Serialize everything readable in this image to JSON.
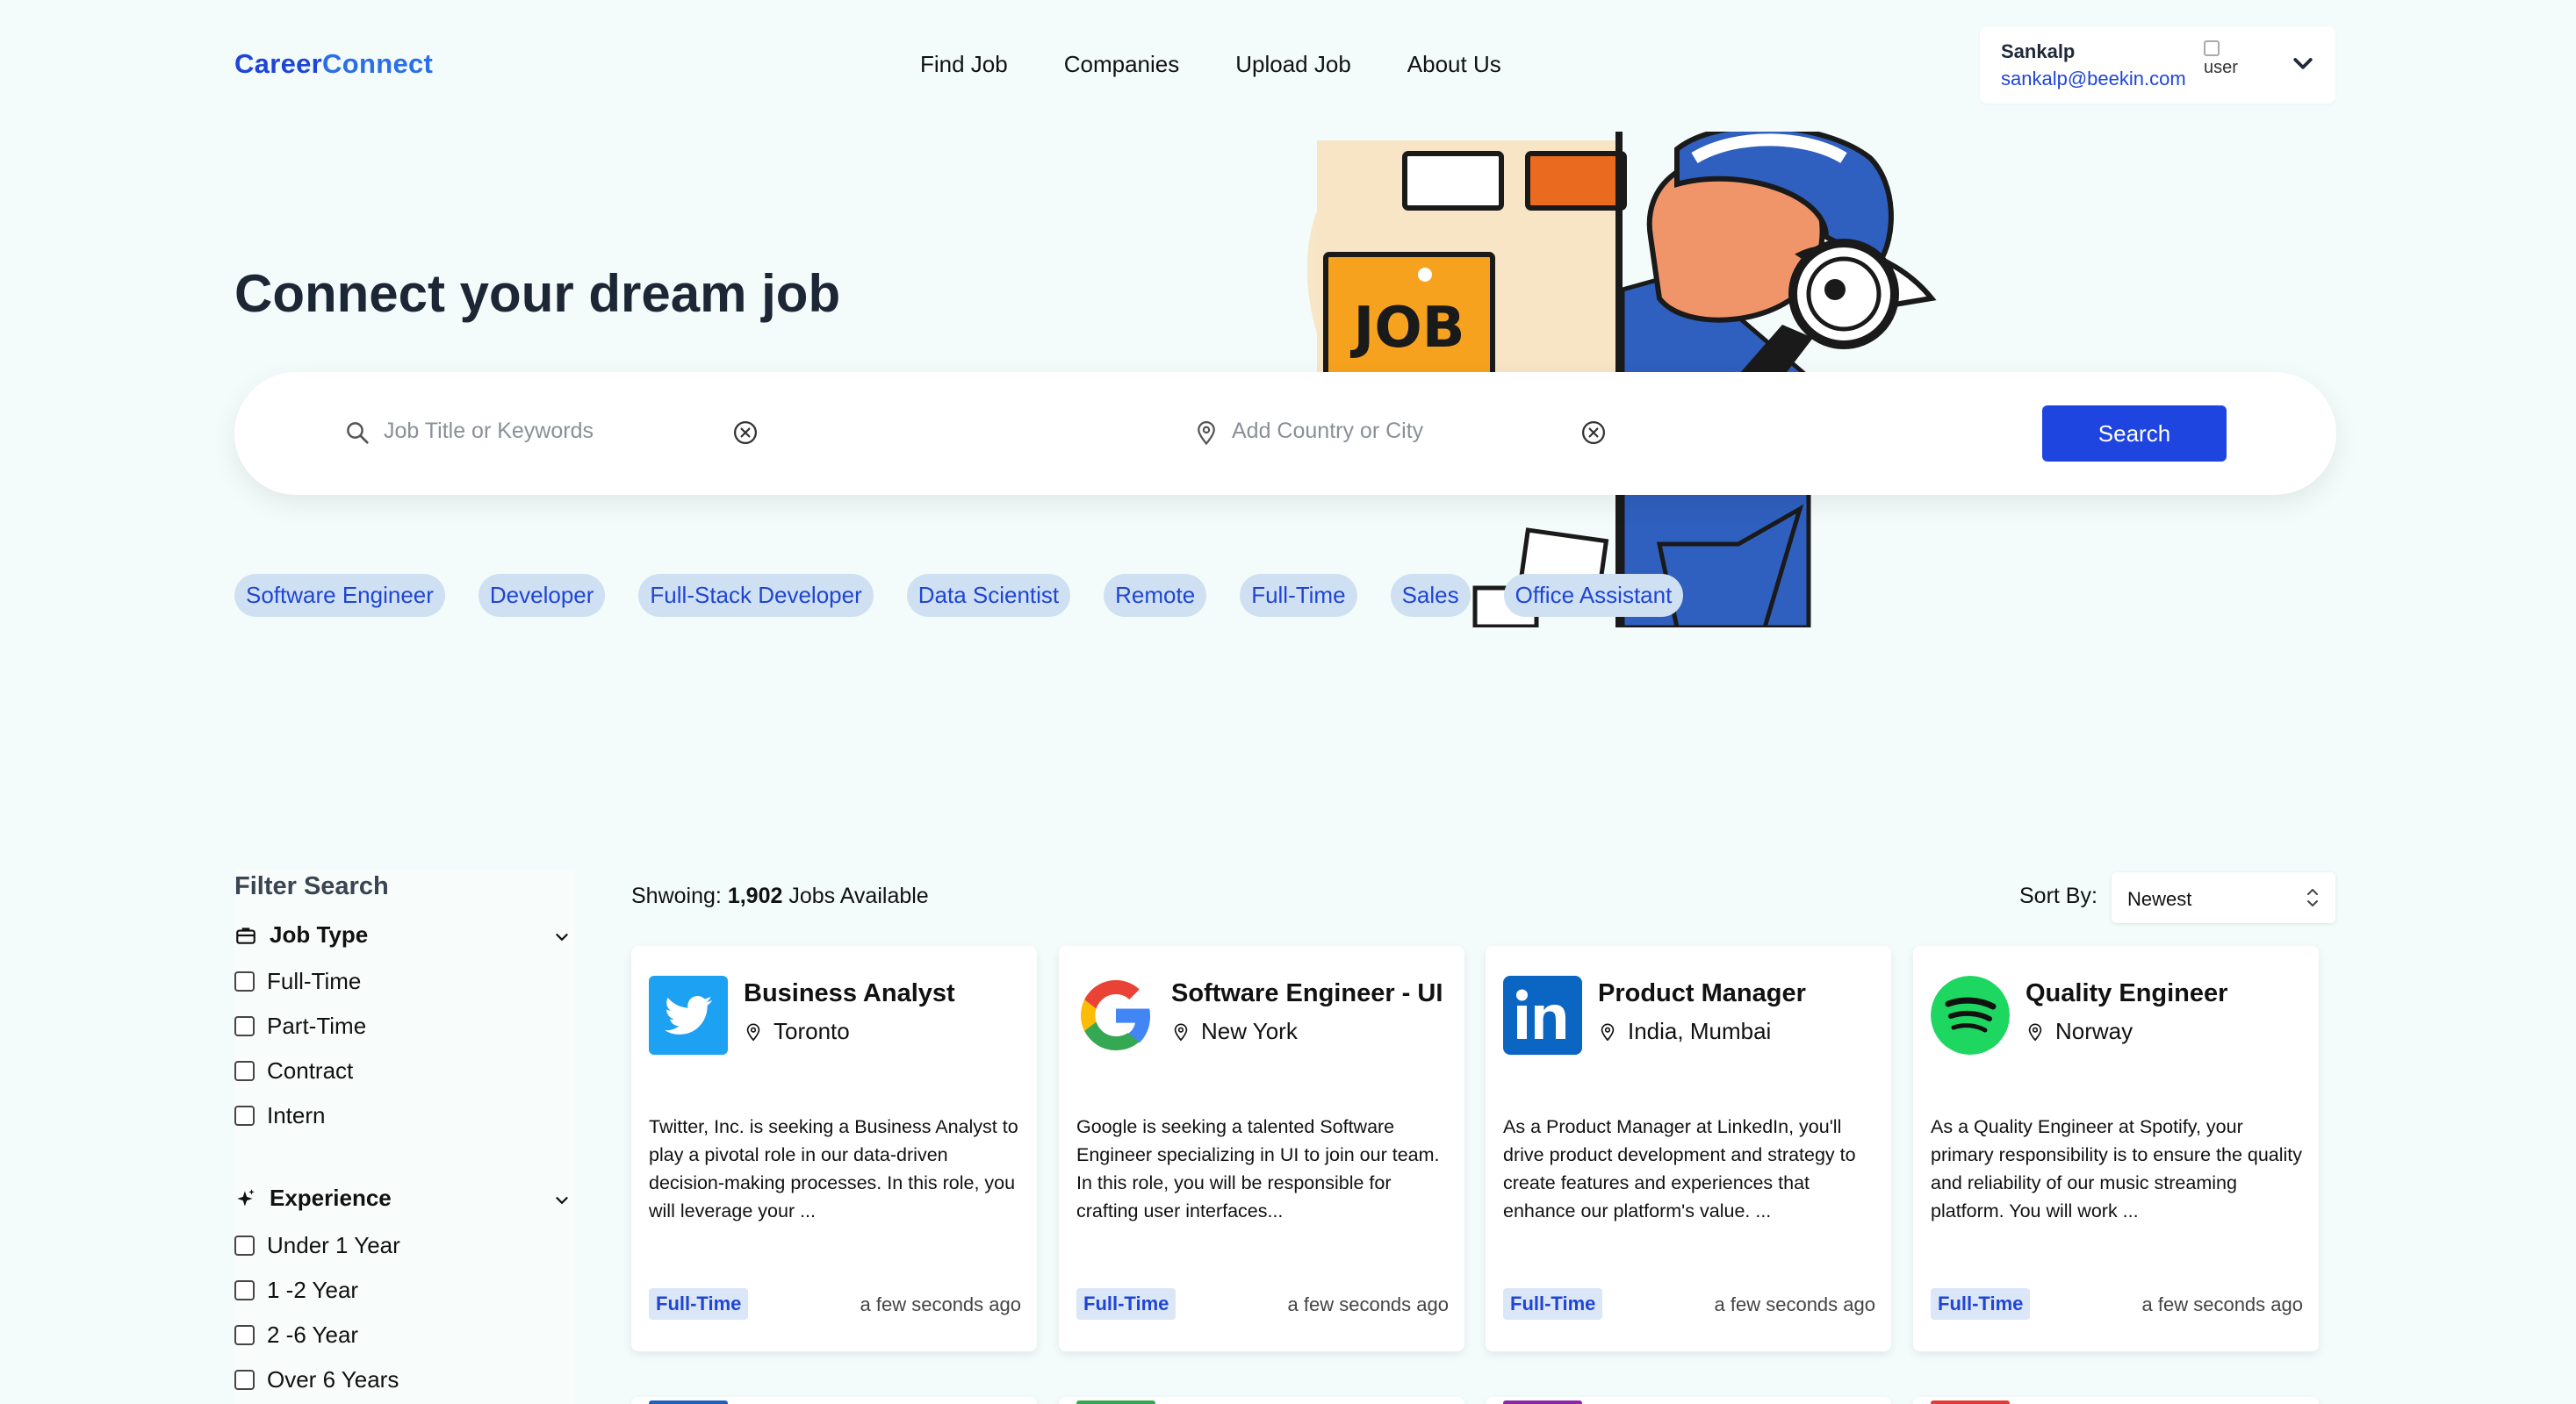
{
  "header": {
    "logo_part1": "Career",
    "logo_part2": "Connect",
    "nav": [
      "Find Job",
      "Companies",
      "Upload Job",
      "About Us"
    ],
    "user": {
      "name": "Sankalp",
      "email": "sankalp@beekin.com",
      "avatar_alt": "user"
    }
  },
  "hero": {
    "title": "Connect your dream job",
    "illustration_text": "JOB",
    "search": {
      "keyword_placeholder": "Job Title or Keywords",
      "location_placeholder": "Add Country or City",
      "button": "Search"
    },
    "tags": [
      "Software Engineer",
      "Developer",
      "Full-Stack Developer",
      "Data Scientist",
      "Remote",
      "Full-Time",
      "Sales",
      "Office Assistant"
    ]
  },
  "filter": {
    "title": "Filter Search",
    "job_type": {
      "label": "Job Type",
      "options": [
        "Full-Time",
        "Part-Time",
        "Contract",
        "Intern"
      ]
    },
    "experience": {
      "label": "Experience",
      "options": [
        "Under 1 Year",
        "1 -2 Year",
        "2 -6 Year",
        "Over 6 Years"
      ]
    }
  },
  "results": {
    "showing_prefix": "Shwoing:",
    "count": "1,902",
    "showing_suffix": "Jobs Available",
    "sort_label": "Sort By:",
    "sort_value": "Newest",
    "jobs": [
      {
        "title": "Business Analyst",
        "location": "Toronto",
        "company_icon": "twitter-icon",
        "description": "Twitter, Inc. is seeking a Business Analyst to play a pivotal role in our data-driven decision-making processes. In this role, you will leverage your ...",
        "type": "Full-Time",
        "posted": "a few seconds ago"
      },
      {
        "title": "Software Engineer - UI",
        "location": "New York",
        "company_icon": "google-icon",
        "description": "Google is seeking a talented Software Engineer specializing in UI to join our team. In this role, you will be responsible for crafting user interfaces...",
        "type": "Full-Time",
        "posted": "a few seconds ago"
      },
      {
        "title": "Product Manager",
        "location": "India, Mumbai",
        "company_icon": "linkedin-icon",
        "description": "As a Product Manager at LinkedIn, you'll drive product development and strategy to create features and experiences that enhance our platform's value. ...",
        "type": "Full-Time",
        "posted": "a few seconds ago"
      },
      {
        "title": "Quality Engineer",
        "location": "Norway",
        "company_icon": "spotify-icon",
        "description": "As a Quality Engineer at Spotify, your primary responsibility is to ensure the quality and reliability of our music streaming platform. You will work ...",
        "type": "Full-Time",
        "posted": "a few seconds ago"
      }
    ]
  },
  "colors": {
    "accent": "#1f45e0",
    "background": "#f3fcfb",
    "tag_bg": "#cfe0f2",
    "badge_bg": "#dbe6f7"
  }
}
